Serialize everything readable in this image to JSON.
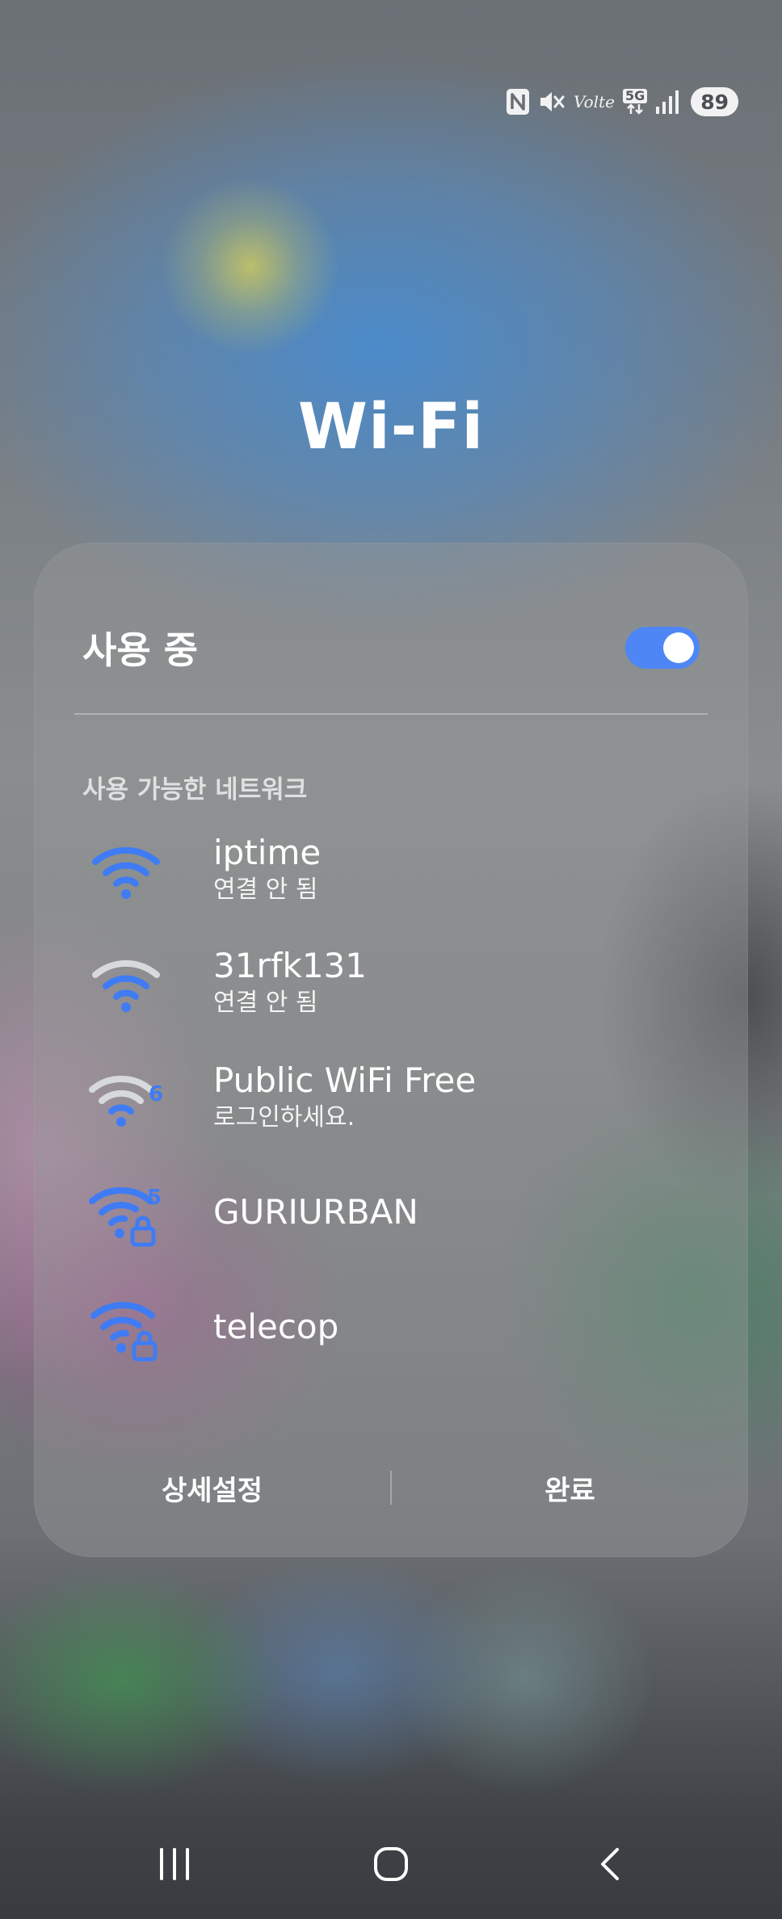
{
  "status_bar": {
    "icons": [
      "nfc-icon",
      "mute-icon",
      "volte-icon",
      "5g-data-icon",
      "signal-icon"
    ],
    "volte_label": "Volte",
    "network_label": "5G",
    "battery": "89"
  },
  "title": "Wi-Fi",
  "wifi_toggle": {
    "label": "사용 중",
    "on": true,
    "accent_color": "#4f86f5"
  },
  "available_networks_label": "사용 가능한 네트워크",
  "networks": [
    {
      "name": "iptime",
      "status": "연결 안 됨",
      "icon": "wifi-full-icon"
    },
    {
      "name": "31rfk131",
      "status": "연결 안 됨",
      "icon": "wifi-weak-icon"
    },
    {
      "name": "Public WiFi Free",
      "status": "로그인하세요.",
      "icon": "wifi6-weak-icon",
      "badge": "6"
    },
    {
      "name": "GURIURBAN",
      "status": "",
      "icon": "wifi5-locked-icon",
      "badge": "5"
    },
    {
      "name": "telecop",
      "status": "",
      "icon": "wifi-locked-icon"
    }
  ],
  "footer": {
    "settings_label": "상세설정",
    "done_label": "완료"
  },
  "nav": {
    "icons": [
      "recents-icon",
      "home-icon",
      "back-icon"
    ]
  }
}
